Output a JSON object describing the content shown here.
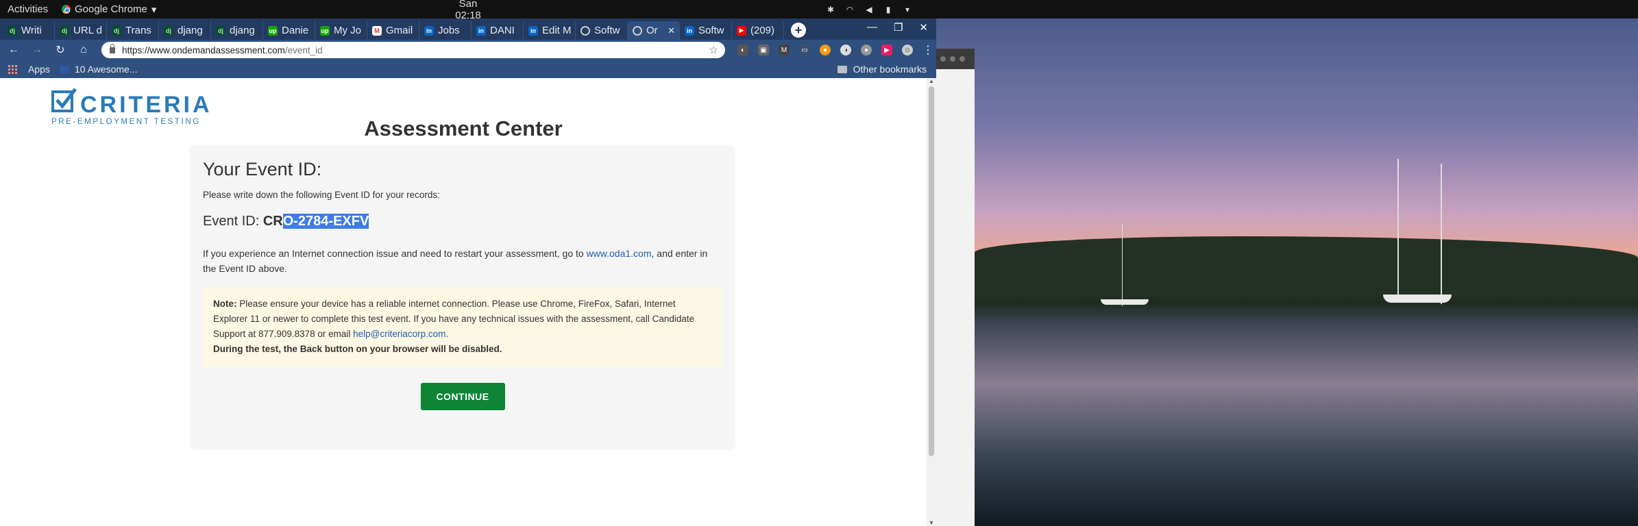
{
  "system_bar": {
    "activities": "Activities",
    "app_name": "Google Chrome",
    "clock": "San 02:18"
  },
  "tabs": [
    {
      "label": "Writi",
      "icon": "dj"
    },
    {
      "label": "URL d",
      "icon": "dj"
    },
    {
      "label": "Trans",
      "icon": "dj"
    },
    {
      "label": "djang",
      "icon": "dj"
    },
    {
      "label": "djang",
      "icon": "dj"
    },
    {
      "label": "Danie",
      "icon": "up"
    },
    {
      "label": "My Jo",
      "icon": "up"
    },
    {
      "label": "Gmail",
      "icon": "M"
    },
    {
      "label": "Jobs",
      "icon": "in"
    },
    {
      "label": "DANI",
      "icon": "in"
    },
    {
      "label": "Edit M",
      "icon": "in"
    },
    {
      "label": "Softw",
      "icon": "globe"
    },
    {
      "label": "Or",
      "icon": "globe",
      "active": true
    },
    {
      "label": "Softw",
      "icon": "in"
    },
    {
      "label": "(209)",
      "icon": "yt"
    }
  ],
  "address_bar": {
    "url_host": "https://www.ondemandassessment.com",
    "url_path": "/event_id"
  },
  "bookmarks": {
    "apps": "Apps",
    "item1": "10 Awesome...",
    "other": "Other bookmarks"
  },
  "page": {
    "logo_brand": "CRITERIA",
    "logo_tagline": "PRE-EMPLOYMENT TESTING",
    "title": "Assessment Center",
    "panel_heading": "Your Event ID:",
    "instruction": "Please write down the following Event ID for your records:",
    "event_label": "Event ID: ",
    "event_code_unselected": "CR",
    "event_code_selected": "O-2784-EXFV",
    "restart_text_before": "If you experience an Internet connection issue and need to restart your assessment, go to ",
    "restart_link": "www.oda1.com",
    "restart_text_after": ", and enter in the Event ID above.",
    "note_label": "Note:",
    "note_text": " Please ensure your device has a reliable internet connection. Please use Chrome, FireFox, Safari, Internet Explorer 11 or newer to complete this test event. If you have any technical issues with the assessment, call Candidate Support at 877.909.8378 or email ",
    "note_email": "help@criteriacorp.com",
    "note_end": ".",
    "note_warning": "During the test, the Back button on your browser will be disabled.",
    "continue_label": "CONTINUE"
  },
  "colors": {
    "chrome_frame": "#233b61",
    "toolbar": "#2f4f7f",
    "brand_blue": "#2b7bb9",
    "continue_green": "#0d8436",
    "selection": "#3d7ce8"
  }
}
